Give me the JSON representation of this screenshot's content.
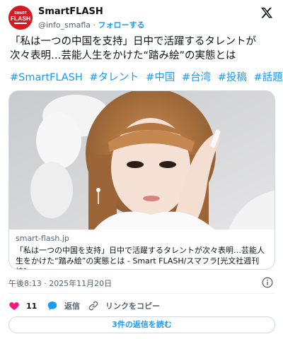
{
  "account": {
    "name": "SmartFLASH",
    "handle": "@info_smafla",
    "separator": "·",
    "follow_label": "フォローする",
    "avatar_text": "FLASH"
  },
  "tweet": {
    "text_line1": "「私は一つの中国を支持」日中で活躍するタレントが",
    "text_line2": "次々表明…芸能人生をかけた“踏み絵”の実態とは",
    "hashtags": [
      "#SmartFLASH",
      "#タレント",
      "#中国",
      "#台湾",
      "#投稿",
      "#話題"
    ]
  },
  "card": {
    "domain": "smart-flash.jp",
    "title": "「私は一つの中国を支持」日中で活躍するタレントが次々表明…芸能人生をかけた“踏み絵”の実態とは - Smart FLASH/スマフラ[光文社週刊誌]"
  },
  "timestamp": "午後8:13 · 2025年11月20日",
  "actions": {
    "like_count": "11",
    "reply_label": "返信",
    "copy_label": "リンクをコピー"
  },
  "read_replies_label": "3件の返信を読む",
  "colors": {
    "accent": "#1d9bf0",
    "like": "#f91880",
    "brand_red": "#d71920"
  },
  "icons": {
    "logo": "x-logo-icon",
    "info": "info-icon",
    "like": "heart-icon",
    "reply": "speech-bubble-icon",
    "copy": "link-icon"
  }
}
